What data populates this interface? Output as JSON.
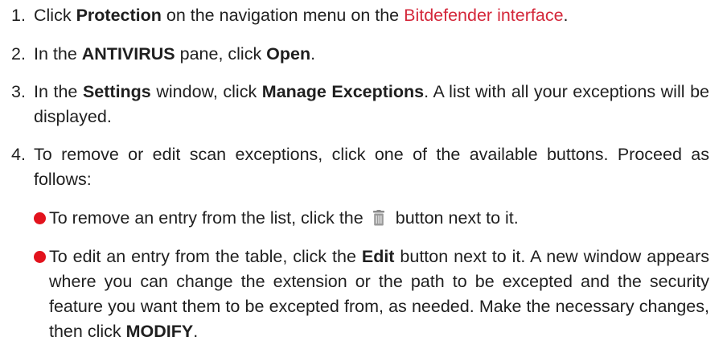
{
  "steps": [
    {
      "num": "1.",
      "t1": "Click ",
      "b1": "Protection",
      "t2": " on the navigation menu on the ",
      "link": "Bitdefender interface",
      "t3": "."
    },
    {
      "num": "2.",
      "t1": "In the ",
      "b1": "ANTIVIRUS",
      "t2": " pane, click ",
      "b2": "Open",
      "t3": "."
    },
    {
      "num": "3.",
      "t1": "In the ",
      "b1": "Settings",
      "t2": " window, click ",
      "b2": "Manage Exceptions",
      "t3": ". A list with all your exceptions will be displayed."
    },
    {
      "num": "4.",
      "t1": "To remove or edit scan exceptions, click one of the available buttons. Proceed as follows:"
    }
  ],
  "bullets": [
    {
      "t1": "To remove an entry from the list, click the",
      "icon": "trash-icon",
      "t2": "button next to it."
    },
    {
      "t1": "To edit an entry from the table, click the ",
      "b1": "Edit",
      "t2": " button next to it. A new window appears where you can change the extension or the path to be excepted and the security feature you want them to be excepted from, as needed. Make the necessary changes, then click ",
      "b2": "MODIFY",
      "t3": "."
    }
  ],
  "colors": {
    "link": "#d4273a",
    "bullet": "#e2131d",
    "text": "#1f1f1f"
  }
}
